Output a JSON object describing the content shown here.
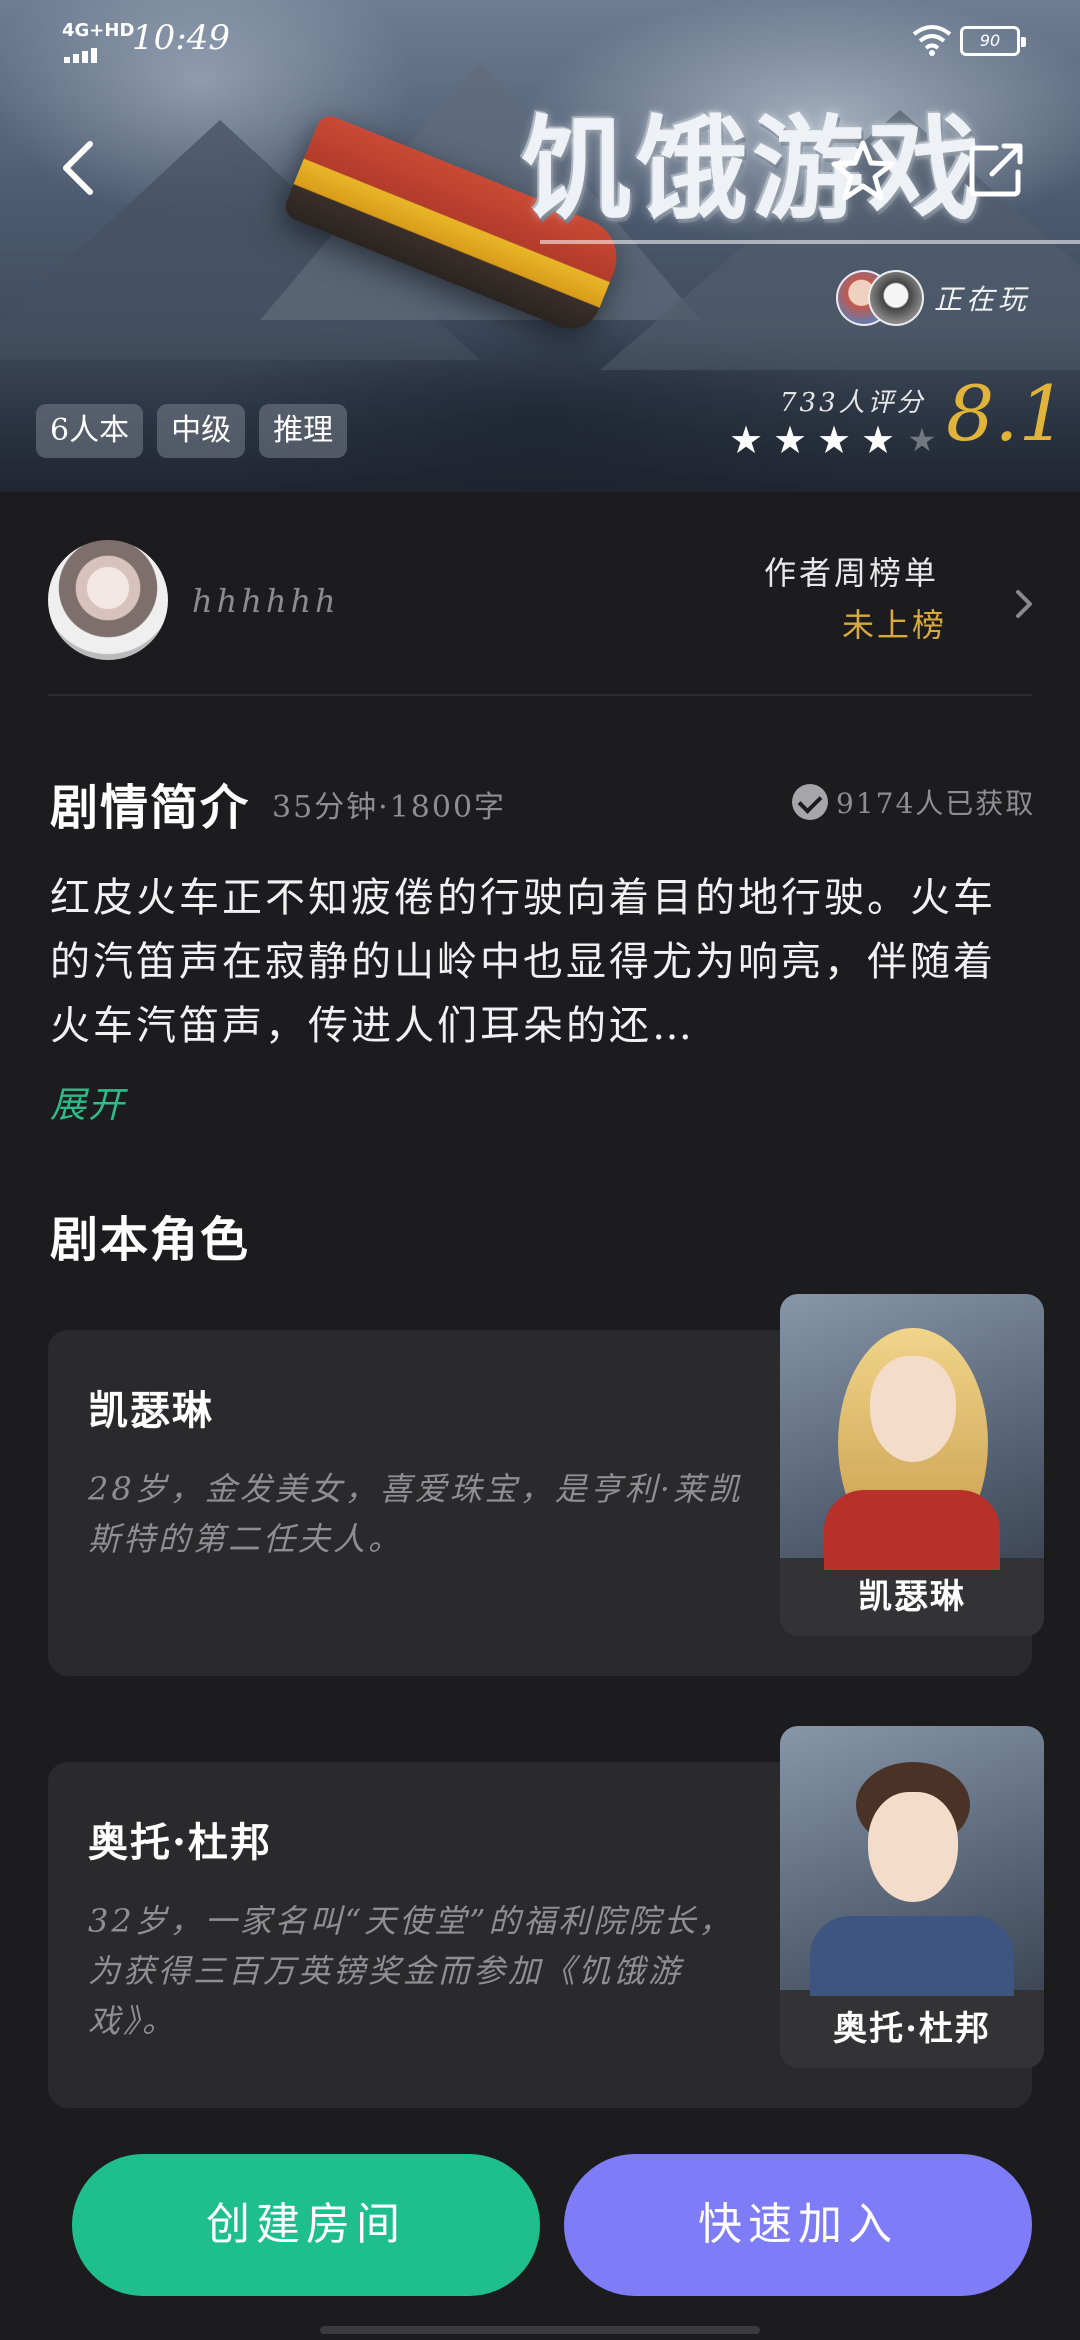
{
  "status_bar": {
    "network": "4G+HD",
    "time": "10:49",
    "battery": "90"
  },
  "header": {
    "title": "饥饿游戏",
    "back_icon": "back-arrow-icon",
    "favorite_icon": "star-outline-icon",
    "share_icon": "share-icon",
    "playing_text": "正在玩",
    "tags": [
      "6人本",
      "中级",
      "推理"
    ],
    "rating_count": "733人评分",
    "rating_stars": 4,
    "rating_score": "8.1"
  },
  "author": {
    "name": "hhhhhh",
    "weekly_title": "作者周榜单",
    "weekly_status": "未上榜"
  },
  "synopsis": {
    "title": "剧情简介",
    "meta": "35分钟·1800字",
    "obtained": "9174人已获取",
    "text": "红皮火车正不知疲倦的行驶向着目的地行驶。火车的汽笛声在寂静的山岭中也显得尤为响亮，伴随着火车汽笛声，传进人们耳朵的还…",
    "expand_label": "展开"
  },
  "roles": {
    "title": "剧本角色",
    "items": [
      {
        "name": "凯瑟琳",
        "description": "28岁，金发美女，喜爱珠宝，是亨利·莱凯斯特的第二任夫人。",
        "portrait_label": "凯瑟琳"
      },
      {
        "name": "奥托·杜邦",
        "description": "32岁，一家名叫“天使堂”的福利院院长，为获得三百万英镑奖金而参加《饥饿游戏》。",
        "portrait_label": "奥托·杜邦"
      }
    ]
  },
  "actions": {
    "create_room": "创建房间",
    "quick_join": "快速加入"
  },
  "colors": {
    "accent_green": "#1fbf8d",
    "accent_purple": "#7f7cf8",
    "gold": "#e0b43a",
    "background": "#1c1c1e",
    "card": "#2a2a2d"
  }
}
